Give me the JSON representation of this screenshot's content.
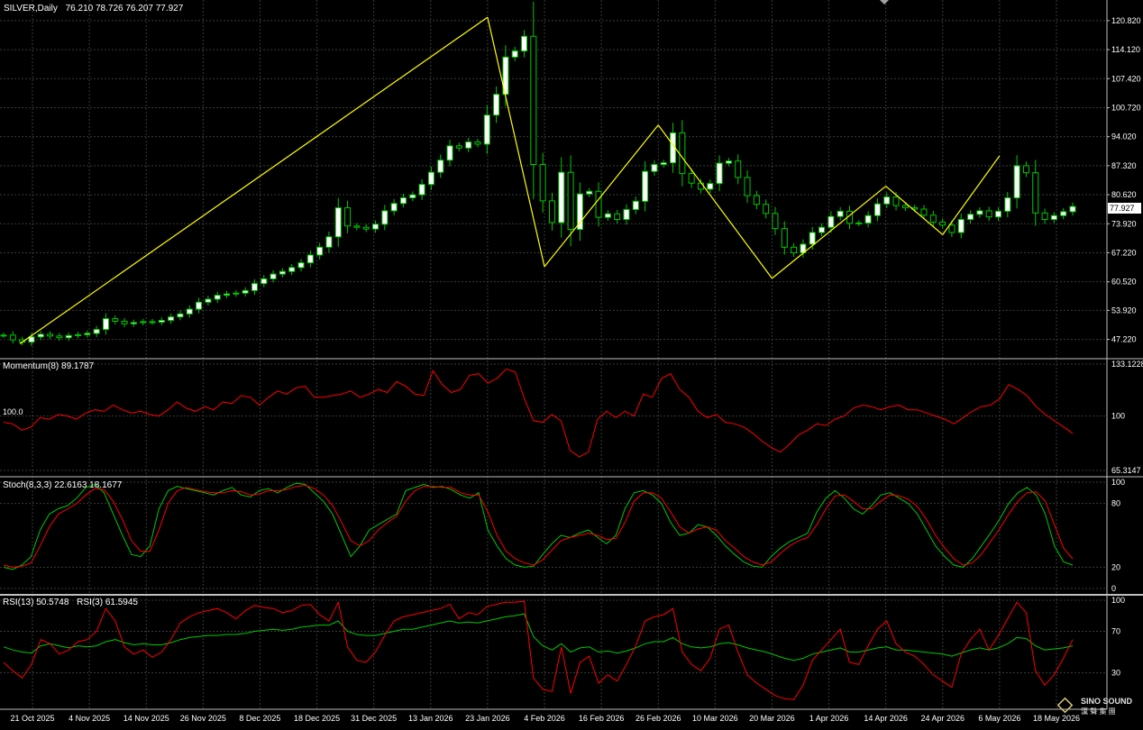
{
  "header": {
    "symbol": "SILVER,Daily",
    "ohlc": "76.210 78.726 76.207 77.927"
  },
  "colors": {
    "background": "#000000",
    "grid": "#3a3a3a",
    "bull_candle": "#00c800",
    "bull_body": "#ffffff",
    "bear_candle": "#00c800",
    "zigzag": "#ffff00",
    "momentum": "#ff0000",
    "stoch_main": "#00c800",
    "stoch_signal": "#ff0000",
    "rsi13": "#00c800",
    "rsi3": "#ff0000",
    "axis_text": "#ffffff",
    "price_tag_bg": "#ffffff",
    "separator": "#c0c0c0"
  },
  "price_axis": {
    "ticks": [
      "120.820",
      "114.120",
      "107.420",
      "100.720",
      "94.020",
      "87.320",
      "80.620",
      "73.920",
      "67.220",
      "60.520",
      "53.920",
      "47.220"
    ],
    "current": "77.927"
  },
  "time_axis": {
    "labels": [
      "21 Oct 2025",
      "4 Nov 2025",
      "14 Nov 2025",
      "26 Nov 2025",
      "8 Dec 2025",
      "18 Dec 2025",
      "31 Dec 2025",
      "13 Jan 2026",
      "23 Jan 2026",
      "4 Feb 2026",
      "16 Feb 2026",
      "26 Feb 2026",
      "10 Mar 2026",
      "20 Mar 2026",
      "1 Apr 2026",
      "14 Apr 2026",
      "24 Apr 2026",
      "6 May 2026",
      "18 May 2026"
    ]
  },
  "momentum": {
    "label": "Momentum(8) 89.1787",
    "level_label": "100.0",
    "ticks": [
      "133.1228",
      "100",
      "65.3147"
    ]
  },
  "stoch": {
    "label": "Stoch(8,3,3) 22.6163 18.1677",
    "ticks": [
      "100",
      "80",
      "20",
      "0"
    ]
  },
  "rsi": {
    "label_13": "RSI(13) 50.5748",
    "label_3": "RSI(3) 61.5945",
    "ticks": [
      "100",
      "70",
      "30"
    ]
  },
  "watermark": {
    "line1": "SINO SOUND",
    "line2": "漢 聲 集 團"
  },
  "chart_data": {
    "type": "candlestick",
    "title": "SILVER,Daily",
    "price_range": [
      43.8,
      123.5
    ],
    "dates": [
      "21 Oct 2025",
      "4 Nov 2025",
      "14 Nov 2025",
      "26 Nov 2025",
      "8 Dec 2025",
      "18 Dec 2025",
      "31 Dec 2025",
      "13 Jan 2026",
      "23 Jan 2026",
      "4 Feb 2026",
      "16 Feb 2026",
      "26 Feb 2026",
      "10 Mar 2026",
      "20 Mar 2026",
      "1 Apr 2026",
      "14 Apr 2026",
      "24 Apr 2026",
      "6 May 2026",
      "18 May 2026"
    ],
    "close_series": [
      48.2,
      47.1,
      46.6,
      47.8,
      48.4,
      48.0,
      47.6,
      48.1,
      48.3,
      48.6,
      49.5,
      52.0,
      51.4,
      50.8,
      51.1,
      51.3,
      51.2,
      51.6,
      52.4,
      53.1,
      54.2,
      55.8,
      56.5,
      57.4,
      57.7,
      57.9,
      58.5,
      60.1,
      61.2,
      62.3,
      62.9,
      63.8,
      64.9,
      66.7,
      68.5,
      70.9,
      77.6,
      73.4,
      73.1,
      72.7,
      73.8,
      76.9,
      78.6,
      79.9,
      80.6,
      83.0,
      85.8,
      88.6,
      91.9,
      91.4,
      92.8,
      92.3,
      99.0,
      103.8,
      112.4,
      113.8,
      117.2,
      87.6,
      79.2,
      74.2,
      85.8,
      72.6,
      80.8,
      81.4,
      75.4,
      76.2,
      74.9,
      77.2,
      79.1,
      86.0,
      87.6,
      88.0,
      94.9,
      85.5,
      83.3,
      81.9,
      83.2,
      87.9,
      88.4,
      84.6,
      80.4,
      78.4,
      76.3,
      72.8,
      68.5,
      67.2,
      69.2,
      71.9,
      73.1,
      75.6,
      76.8,
      74.0,
      74.1,
      75.8,
      78.5,
      80.1,
      78.1,
      77.6,
      77.3,
      75.9,
      74.3,
      73.6,
      71.9,
      74.9,
      76.1,
      76.9,
      75.5,
      76.8,
      79.9,
      87.3,
      85.7,
      76.4,
      74.9,
      75.8,
      76.7,
      77.9
    ],
    "zigzag": [
      {
        "date": "21 Oct 2025",
        "price": 46.2
      },
      {
        "date": "23 Jan 2026",
        "price": 121.6
      },
      {
        "date": "4 Feb 2026",
        "price": 64.0
      },
      {
        "date": "26 Feb 2026",
        "price": 96.7
      },
      {
        "date": "20 Mar 2026",
        "price": 61.3
      },
      {
        "date": "14 Apr 2026",
        "price": 82.6
      },
      {
        "date": "24 Apr 2026",
        "price": 71.4
      },
      {
        "date": "6 May 2026",
        "price": 89.6
      }
    ],
    "momentum_range": [
      65.3147,
      133.1228
    ],
    "momentum_values": [
      96,
      95,
      91,
      93,
      99,
      98,
      101,
      100,
      98,
      102,
      104,
      103,
      107,
      104,
      102,
      103,
      101,
      100,
      104,
      109,
      105,
      103,
      106,
      104,
      109,
      108,
      113,
      112,
      107,
      112,
      116,
      114,
      118,
      119,
      112,
      112,
      113,
      114,
      116,
      112,
      114,
      117,
      115,
      122,
      119,
      114,
      113,
      129,
      120,
      115,
      117,
      126,
      127,
      121,
      124,
      130,
      128,
      111,
      97,
      96,
      101,
      97,
      78,
      74,
      77,
      98,
      103,
      99,
      103,
      100,
      114,
      112,
      124,
      127,
      117,
      112,
      103,
      99,
      101,
      96,
      95,
      93,
      89,
      84,
      80,
      77,
      82,
      88,
      91,
      95,
      94,
      98,
      100,
      105,
      107,
      106,
      104,
      106,
      107,
      104,
      104,
      102,
      100,
      98,
      95,
      99,
      103,
      106,
      107,
      111,
      120,
      117,
      113,
      106,
      101,
      97,
      93,
      89
    ],
    "stoch_k": [
      20,
      18,
      22,
      30,
      55,
      70,
      75,
      78,
      85,
      95,
      98,
      90,
      70,
      50,
      32,
      30,
      40,
      75,
      92,
      96,
      94,
      92,
      90,
      88,
      92,
      95,
      88,
      86,
      92,
      94,
      90,
      95,
      99,
      98,
      90,
      82,
      70,
      50,
      30,
      40,
      55,
      60,
      65,
      70,
      92,
      95,
      98,
      95,
      96,
      93,
      88,
      85,
      90,
      55,
      40,
      28,
      22,
      20,
      21,
      32,
      42,
      50,
      48,
      52,
      55,
      48,
      42,
      50,
      75,
      90,
      92,
      88,
      80,
      62,
      50,
      52,
      60,
      58,
      50,
      40,
      32,
      25,
      21,
      20,
      30,
      38,
      44,
      48,
      52,
      72,
      85,
      92,
      85,
      75,
      70,
      78,
      88,
      90,
      85,
      80,
      70,
      55,
      40,
      30,
      22,
      20,
      28,
      40,
      52,
      65,
      80,
      90,
      95,
      88,
      70,
      40,
      25,
      22
    ],
    "stoch_d": [
      22,
      20,
      21,
      24,
      40,
      58,
      70,
      75,
      80,
      88,
      94,
      93,
      82,
      65,
      45,
      35,
      35,
      55,
      80,
      92,
      95,
      93,
      91,
      90,
      90,
      92,
      91,
      88,
      89,
      92,
      92,
      93,
      96,
      97,
      94,
      88,
      78,
      62,
      45,
      40,
      45,
      55,
      62,
      68,
      82,
      92,
      96,
      96,
      95,
      95,
      90,
      88,
      88,
      72,
      50,
      35,
      28,
      24,
      22,
      27,
      36,
      45,
      48,
      50,
      52,
      50,
      46,
      47,
      62,
      82,
      90,
      90,
      85,
      72,
      58,
      52,
      56,
      58,
      55,
      45,
      38,
      30,
      25,
      22,
      25,
      33,
      40,
      45,
      48,
      60,
      75,
      87,
      88,
      82,
      75,
      75,
      82,
      88,
      87,
      84,
      77,
      65,
      50,
      38,
      28,
      22,
      24,
      32,
      44,
      56,
      70,
      82,
      90,
      91,
      82,
      60,
      38,
      28
    ],
    "rsi13": [
      55,
      52,
      50,
      49,
      56,
      58,
      56,
      54,
      56,
      55,
      56,
      60,
      62,
      59,
      57,
      58,
      57,
      57,
      59,
      62,
      64,
      65,
      66,
      66,
      67,
      67,
      68,
      70,
      71,
      72,
      71,
      72,
      74,
      75,
      76,
      76,
      80,
      70,
      67,
      66,
      66,
      68,
      70,
      72,
      72,
      74,
      76,
      78,
      80,
      78,
      79,
      78,
      80,
      82,
      84,
      85,
      87,
      65,
      56,
      52,
      58,
      50,
      54,
      55,
      50,
      51,
      49,
      51,
      54,
      58,
      60,
      60,
      64,
      58,
      55,
      54,
      55,
      58,
      59,
      57,
      54,
      52,
      50,
      47,
      44,
      42,
      44,
      48,
      50,
      52,
      54,
      50,
      50,
      52,
      54,
      55,
      52,
      52,
      51,
      50,
      49,
      48,
      46,
      49,
      52,
      54,
      52,
      54,
      58,
      64,
      63,
      56,
      52,
      53,
      54,
      56
    ],
    "rsi3": [
      40,
      32,
      25,
      38,
      62,
      58,
      48,
      52,
      60,
      62,
      70,
      92,
      80,
      55,
      48,
      52,
      45,
      50,
      62,
      78,
      84,
      88,
      90,
      92,
      88,
      82,
      90,
      95,
      93,
      92,
      88,
      90,
      95,
      96,
      86,
      80,
      98,
      55,
      42,
      40,
      50,
      66,
      80,
      84,
      86,
      88,
      90,
      92,
      96,
      82,
      88,
      86,
      94,
      96,
      98,
      98,
      99,
      25,
      14,
      12,
      55,
      10,
      40,
      46,
      20,
      28,
      22,
      38,
      56,
      80,
      84,
      86,
      92,
      50,
      38,
      32,
      44,
      72,
      76,
      50,
      28,
      20,
      14,
      8,
      5,
      4,
      18,
      42,
      52,
      62,
      72,
      40,
      38,
      56,
      72,
      80,
      58,
      50,
      46,
      38,
      28,
      22,
      16,
      48,
      62,
      72,
      52,
      66,
      82,
      98,
      88,
      32,
      18,
      28,
      44,
      62
    ]
  }
}
